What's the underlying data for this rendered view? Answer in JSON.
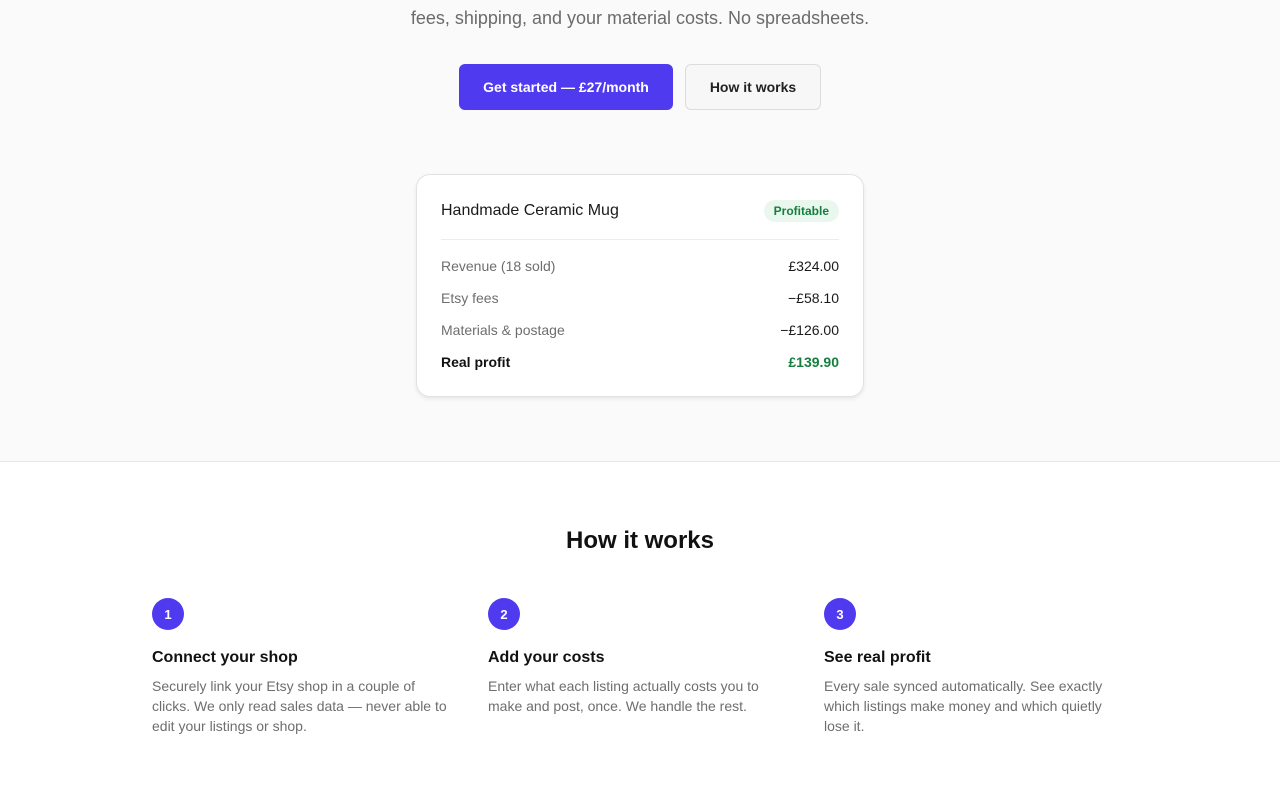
{
  "hero": {
    "subline": "fees, shipping, and your material costs. No spreadsheets.",
    "primary_cta": "Get started — £27/month",
    "secondary_cta": "How it works"
  },
  "card": {
    "title": "Handmade Ceramic Mug",
    "badge": "Profitable",
    "rows": [
      {
        "label": "Revenue (18 sold)",
        "value": "£324.00"
      },
      {
        "label": "Etsy fees",
        "value": "−£58.10"
      },
      {
        "label": "Materials & postage",
        "value": "−£126.00"
      },
      {
        "label": "Real profit",
        "value": "£139.90"
      }
    ]
  },
  "how": {
    "title": "How it works",
    "steps": [
      {
        "number": "1",
        "title": "Connect your shop",
        "description": "Securely link your Etsy shop in a couple of clicks. We only read sales data — never able to edit your listings or shop."
      },
      {
        "number": "2",
        "title": "Add your costs",
        "description": "Enter what each listing actually costs you to make and post, once. We handle the rest."
      },
      {
        "number": "3",
        "title": "See real profit",
        "description": "Every sale synced automatically. See exactly which listings make money and which quietly lose it."
      }
    ]
  },
  "colors": {
    "accent": "#4f3af0",
    "profit_green": "#15803d"
  }
}
